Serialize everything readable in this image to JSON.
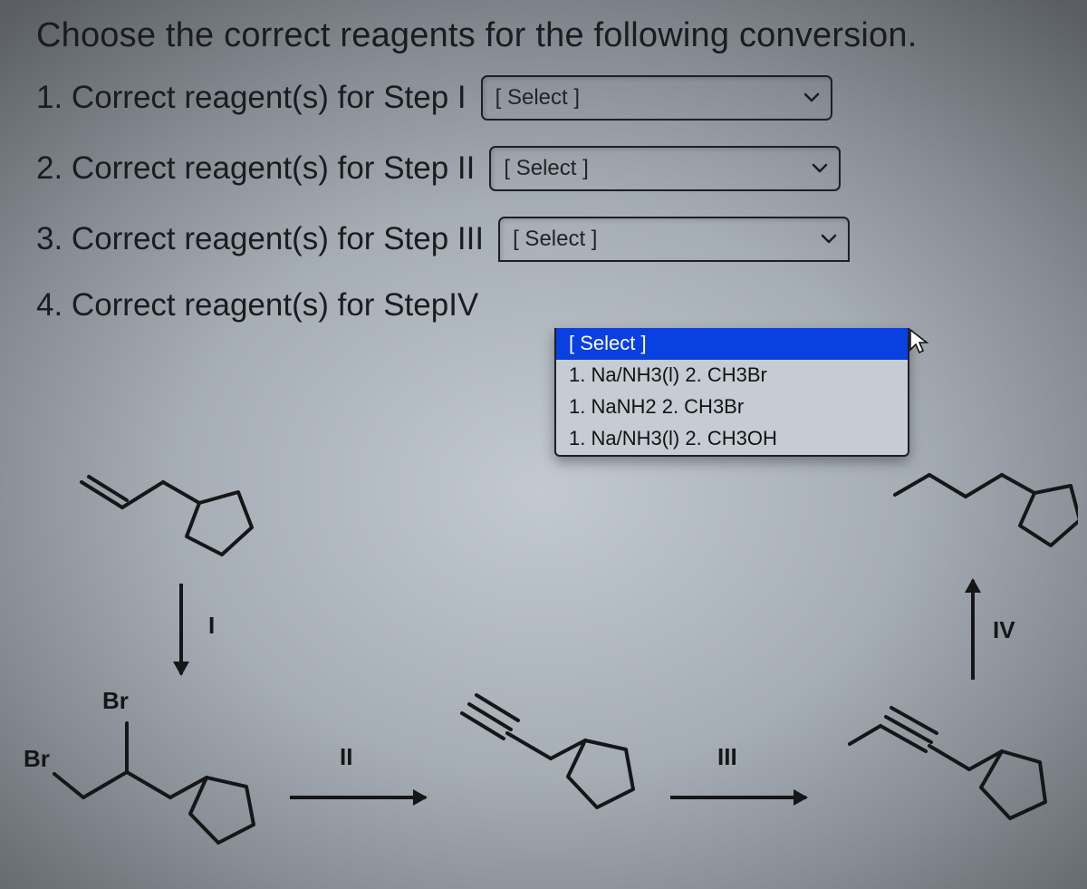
{
  "heading": "Choose the correct reagents for the following conversion.",
  "rows": {
    "r1": {
      "label": "1. Correct reagent(s) for Step I",
      "placeholder": "[ Select ]"
    },
    "r2": {
      "label": "2. Correct reagent(s) for Step II",
      "placeholder": "[ Select ]"
    },
    "r3": {
      "label": "3. Correct reagent(s) for Step III",
      "placeholder": "[ Select ]"
    },
    "r4": {
      "label": "4. Correct reagent(s) for StepIV"
    }
  },
  "dropdown": {
    "options": {
      "o0": "[ Select ]",
      "o1": "1. Na/NH3(l) 2. CH3Br",
      "o2": "1. NaNH2 2. CH3Br",
      "o3": "1. Na/NH3(l) 2. CH3OH"
    }
  },
  "diagram": {
    "step1": "I",
    "step2": "II",
    "step3": "III",
    "step4": "IV",
    "br1": "Br",
    "br2": "Br"
  }
}
